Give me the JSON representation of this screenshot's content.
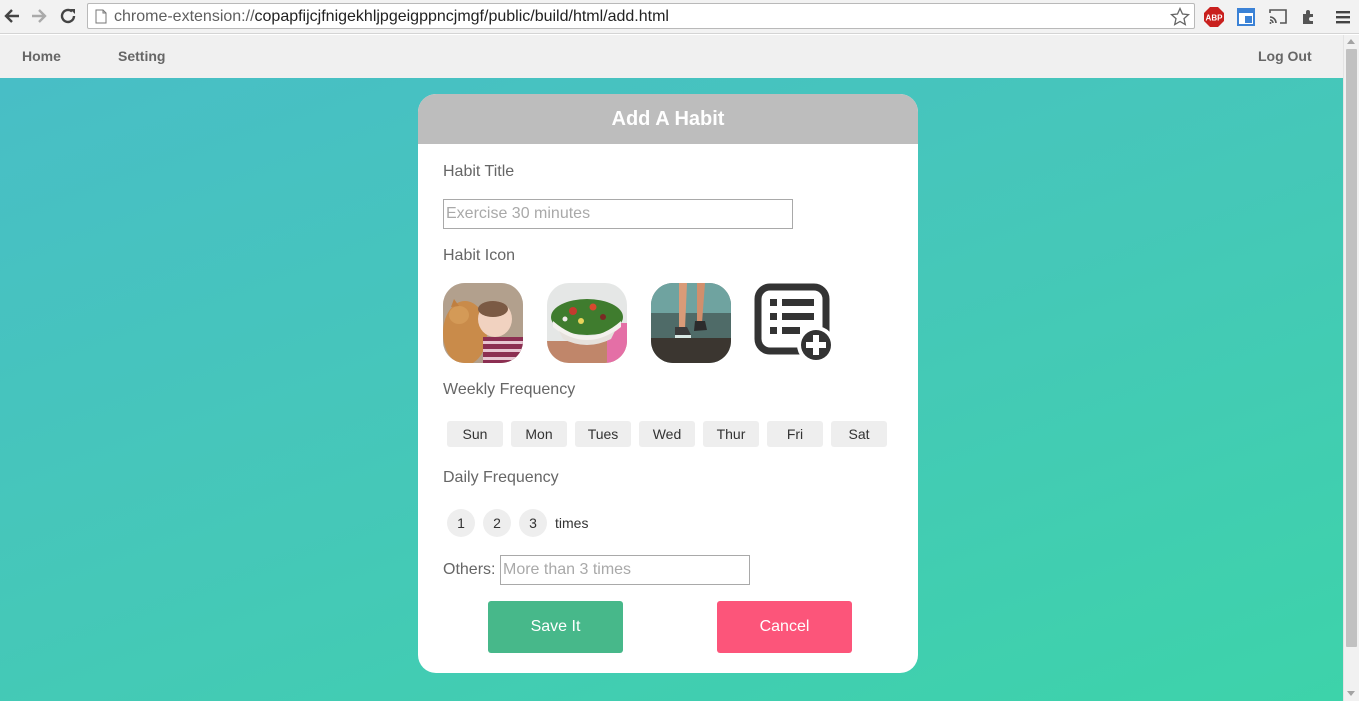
{
  "browser": {
    "url_prefix": "chrome-extension://",
    "url_rest": "copapfijcjfnigekhljpgeigppncjmgf/public/build/html/add.html",
    "abp_label": "ABP"
  },
  "nav": {
    "home": "Home",
    "setting": "Setting",
    "logout": "Log Out"
  },
  "card": {
    "title": "Add A Habit",
    "habit_title_label": "Habit Title",
    "habit_title_placeholder": "Exercise 30 minutes",
    "habit_icon_label": "Habit Icon",
    "icons": [
      "baby-cat-icon",
      "salad-bowl-icon",
      "running-feet-icon",
      "add-list-icon"
    ],
    "weekly_label": "Weekly Frequency",
    "days": [
      "Sun",
      "Mon",
      "Tues",
      "Wed",
      "Thur",
      "Fri",
      "Sat"
    ],
    "daily_label": "Daily Frequency",
    "daily_options": [
      "1",
      "2",
      "3"
    ],
    "times_label": "times",
    "others_label": "Others:",
    "others_placeholder": "More than 3 times",
    "save_label": "Save It",
    "cancel_label": "Cancel"
  },
  "colors": {
    "save": "#47b88a",
    "cancel": "#fc557a",
    "header": "#bdbdbd",
    "bg_start": "#48bec6",
    "bg_end": "#3dd3aa"
  }
}
